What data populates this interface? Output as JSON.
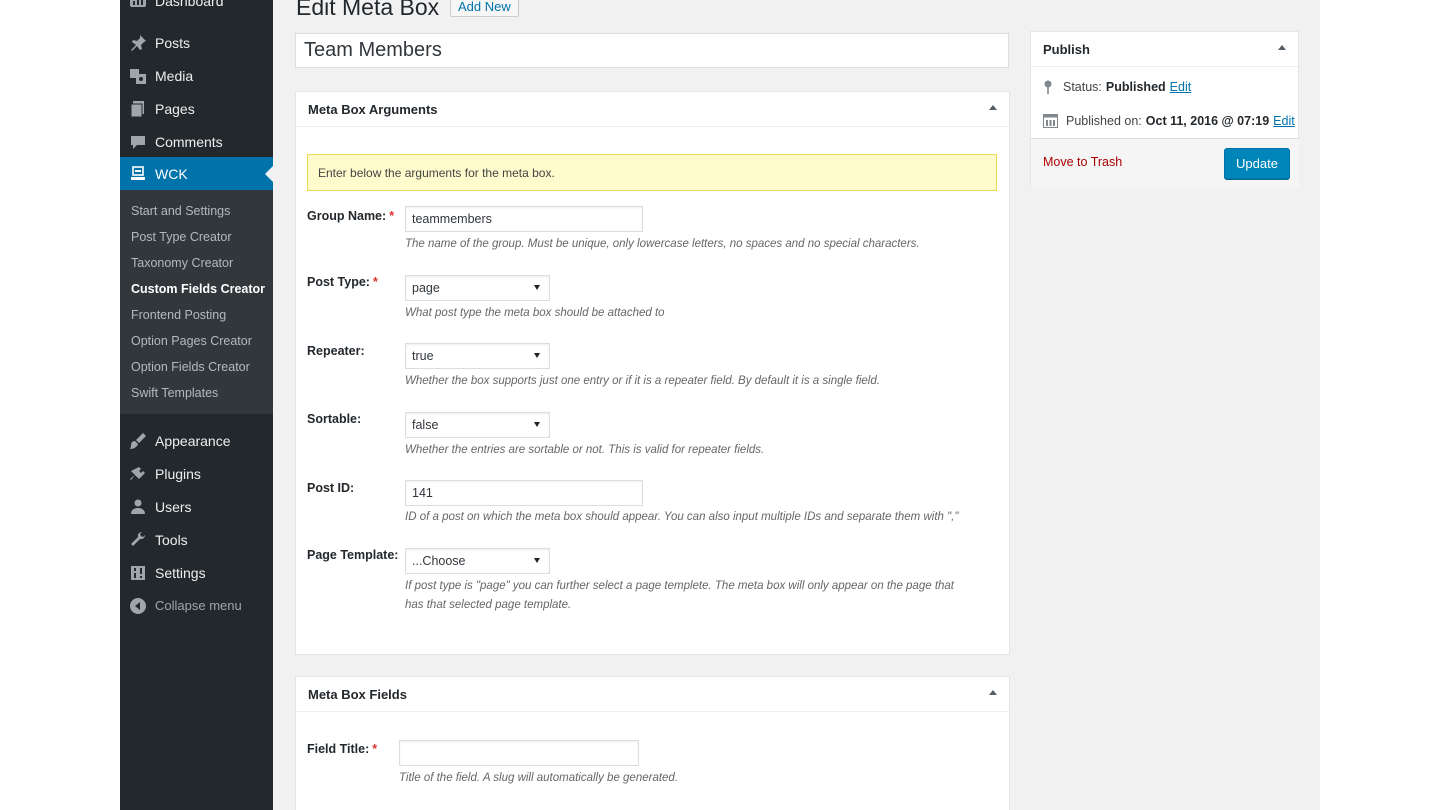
{
  "menu": {
    "top_items": [
      {
        "label": "Dashboard",
        "icon": "dashboard-icon"
      },
      {
        "label": "Posts",
        "icon": "pin-icon"
      },
      {
        "label": "Media",
        "icon": "media-icon"
      },
      {
        "label": "Pages",
        "icon": "pages-icon"
      },
      {
        "label": "Comments",
        "icon": "comments-icon"
      },
      {
        "label": "WCK",
        "icon": "wck-icon"
      }
    ],
    "submenu": [
      {
        "label": "Start and Settings"
      },
      {
        "label": "Post Type Creator"
      },
      {
        "label": "Taxonomy Creator"
      },
      {
        "label": "Custom Fields Creator"
      },
      {
        "label": "Frontend Posting"
      },
      {
        "label": "Option Pages Creator"
      },
      {
        "label": "Option Fields Creator"
      },
      {
        "label": "Swift Templates"
      }
    ],
    "bottom_items": [
      {
        "label": "Appearance",
        "icon": "appearance-icon"
      },
      {
        "label": "Plugins",
        "icon": "plugins-icon"
      },
      {
        "label": "Users",
        "icon": "users-icon"
      },
      {
        "label": "Tools",
        "icon": "tools-icon"
      },
      {
        "label": "Settings",
        "icon": "settings-icon"
      }
    ],
    "collapse_label": "Collapse menu"
  },
  "header": {
    "title": "Edit Meta Box",
    "add_new": "Add New"
  },
  "post_title": "Team Members",
  "args_box": {
    "title": "Meta Box Arguments",
    "notice": "Enter below the arguments for the meta box.",
    "fields": [
      {
        "label": "Group Name:",
        "required": "*",
        "value": "teammembers",
        "desc": "The name of the group. Must be unique, only lowercase letters, no spaces and no special characters."
      },
      {
        "label": "Post Type:",
        "required": "*",
        "value": "page",
        "desc": "What post type the meta box should be attached to"
      },
      {
        "label": "Repeater:",
        "value": "true",
        "desc": "Whether the box supports just one entry or if it is a repeater field. By default it is a single field."
      },
      {
        "label": "Sortable:",
        "value": "false",
        "desc": "Whether the entries are sortable or not. This is valid for repeater fields."
      },
      {
        "label": "Post ID:",
        "value": "141",
        "desc": "ID of a post on which the meta box should appear. You can also input multiple IDs and separate them with \",\""
      },
      {
        "label": "Page Template:",
        "value": "...Choose",
        "desc_line1": "If post type is \"page\" you can further select a page templete. The meta box will only appear on the page that",
        "desc_line2": "has that selected page template."
      }
    ]
  },
  "fields_box": {
    "title": "Meta Box Fields",
    "field_title_label": "Field Title:",
    "required": "*",
    "field_title_value": "",
    "field_title_desc": "Title of the field. A slug will automatically be generated."
  },
  "publish": {
    "title": "Publish",
    "status_label": "Status:",
    "status_value": "Published",
    "published_label": "Published on:",
    "published_value": "Oct 11, 2016 @ 07:19",
    "edit": "Edit",
    "trash": "Move to Trash",
    "update": "Update"
  },
  "colors": {
    "accent": "#0073aa",
    "sidebar": "#23282d",
    "submenu": "#32373c",
    "button": "#0085ba",
    "notice": "#fffbcc"
  }
}
